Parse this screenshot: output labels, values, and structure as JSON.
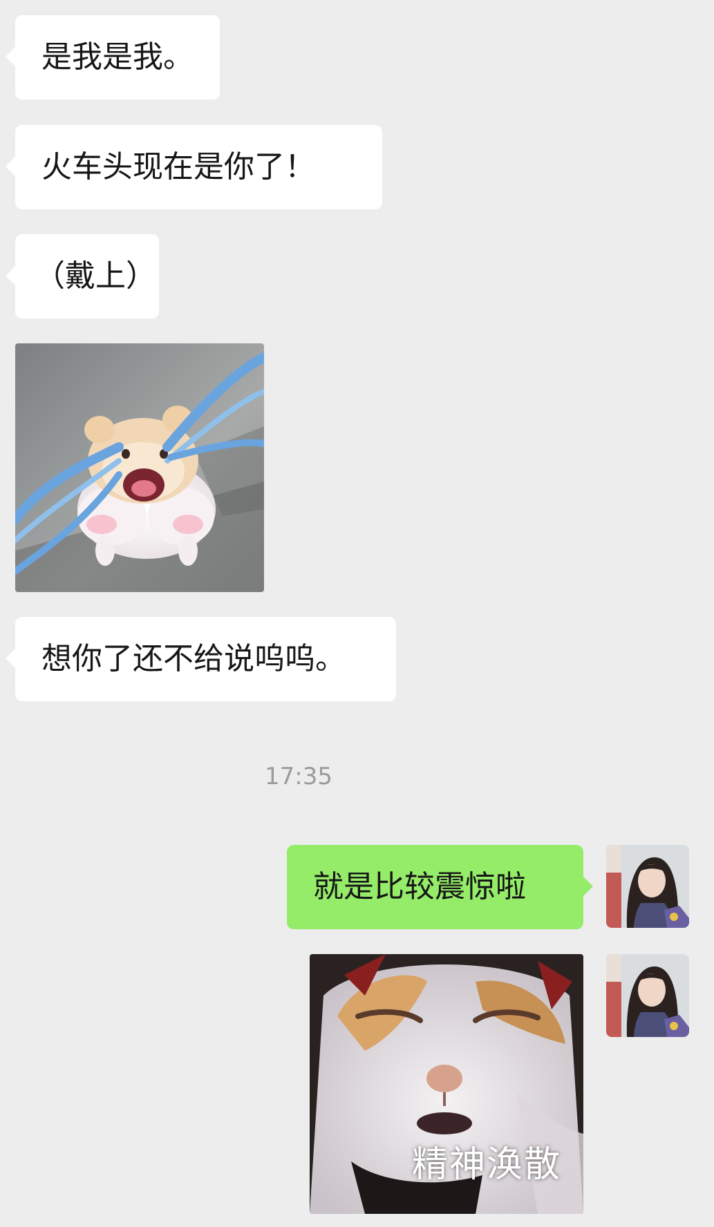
{
  "messages": [
    {
      "side": "in",
      "type": "text",
      "text": "是我是我。"
    },
    {
      "side": "in",
      "type": "text",
      "text": "火车头现在是你了！"
    },
    {
      "side": "in",
      "type": "text",
      "text": "（戴上）"
    },
    {
      "side": "in",
      "type": "sticker",
      "sticker": "crying-hamster-sticker"
    },
    {
      "side": "in",
      "type": "text",
      "text": "想你了还不给说呜呜。"
    }
  ],
  "timestamp": "17:35",
  "outgoing": [
    {
      "side": "out",
      "type": "text",
      "text": "就是比较震惊啦"
    },
    {
      "side": "out",
      "type": "sticker",
      "sticker": "cat-meme-sticker",
      "caption": "精神涣散"
    }
  ],
  "colors": {
    "background": "#ededed",
    "incoming_bubble": "#ffffff",
    "outgoing_bubble": "#95ec69",
    "timestamp": "#9b9b9b"
  }
}
